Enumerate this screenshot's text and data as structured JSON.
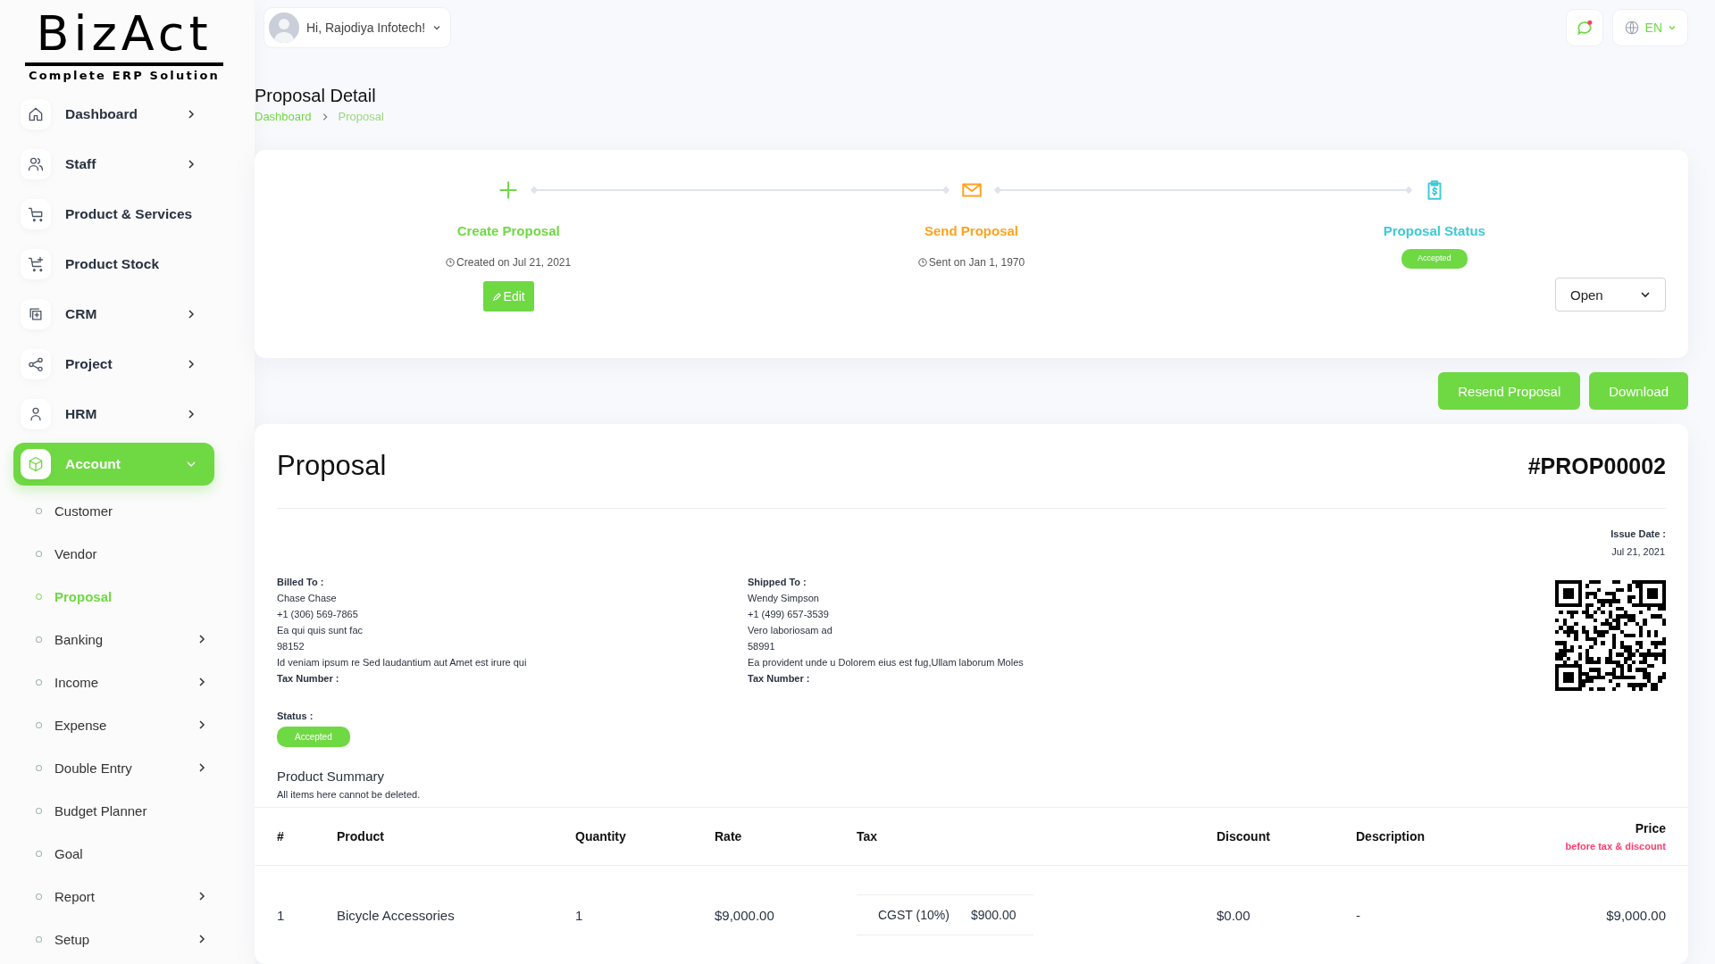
{
  "logo": {
    "title": "BizAct",
    "tagline": "Complete ERP Solution"
  },
  "sidebar": {
    "items": [
      {
        "label": "Dashboard",
        "selected": false,
        "has_submenu": true,
        "expanded": false
      },
      {
        "label": "Staff",
        "selected": false,
        "has_submenu": true,
        "expanded": false
      },
      {
        "label": "Product & Services",
        "selected": false,
        "has_submenu": false
      },
      {
        "label": "Product Stock",
        "selected": false,
        "has_submenu": false
      },
      {
        "label": "CRM",
        "selected": false,
        "has_submenu": true,
        "expanded": false
      },
      {
        "label": "Project",
        "selected": false,
        "has_submenu": true,
        "expanded": false
      },
      {
        "label": "HRM",
        "selected": false,
        "has_submenu": true,
        "expanded": false
      },
      {
        "label": "Account",
        "selected": true,
        "has_submenu": true,
        "expanded": true,
        "children": [
          {
            "label": "Customer",
            "selected": false,
            "has_submenu": false
          },
          {
            "label": "Vendor",
            "selected": false,
            "has_submenu": false
          },
          {
            "label": "Proposal",
            "selected": true,
            "has_submenu": false
          },
          {
            "label": "Banking",
            "selected": false,
            "has_submenu": true
          },
          {
            "label": "Income",
            "selected": false,
            "has_submenu": true
          },
          {
            "label": "Expense",
            "selected": false,
            "has_submenu": true
          },
          {
            "label": "Double Entry",
            "selected": false,
            "has_submenu": true
          },
          {
            "label": "Budget Planner",
            "selected": false,
            "has_submenu": false
          },
          {
            "label": "Goal",
            "selected": false,
            "has_submenu": false
          },
          {
            "label": "Report",
            "selected": false,
            "has_submenu": true
          },
          {
            "label": "Setup",
            "selected": false,
            "has_submenu": true
          }
        ]
      }
    ]
  },
  "header": {
    "greeting": "Hi, Rajodiya Infotech!",
    "language": "EN"
  },
  "page": {
    "title": "Proposal Detail",
    "breadcrumb": [
      "Dashboard",
      "Proposal"
    ]
  },
  "steps": [
    {
      "kind": "create",
      "title": "Create Proposal",
      "note": "Created on Jul 21, 2021",
      "action": "Edit"
    },
    {
      "kind": "send",
      "title": "Send Proposal",
      "note": "Sent on Jan 1, 1970"
    },
    {
      "kind": "status",
      "title": "Proposal Status",
      "badge": "Accepted"
    }
  ],
  "status_select": {
    "value": "Open"
  },
  "actions": [
    "Resend Proposal",
    "Download"
  ],
  "proposal": {
    "title": "Proposal",
    "number": "#PROP00002",
    "issue_date_label": "Issue Date :",
    "issue_date": "Jul 21, 2021",
    "billed": {
      "label": "Billed To :",
      "lines": [
        "Chase Chase",
        "+1 (306) 569-7865",
        "Ea qui quis sunt fac",
        "98152",
        "Id veniam ipsum re Sed laudantium aut Amet est irure qui"
      ],
      "tax_label": "Tax Number :"
    },
    "shipped": {
      "label": "Shipped To :",
      "lines": [
        "Wendy Simpson",
        "+1 (499) 657-3539",
        "Vero laboriosam ad",
        "58991",
        "Ea provident unde u Dolorem eius est fug,Ullam laborum Moles"
      ],
      "tax_label": "Tax Number :"
    },
    "status_label": "Status :",
    "status": "Accepted"
  },
  "summary": {
    "title": "Product Summary",
    "note": "All items here cannot be deleted.",
    "columns": [
      "#",
      "Product",
      "Quantity",
      "Rate",
      "Tax",
      "Discount",
      "Description",
      "Price"
    ],
    "price_note": "before tax & discount",
    "rows": [
      {
        "index": "1",
        "product": "Bicycle Accessories",
        "quantity": "1",
        "rate": "$9,000.00",
        "taxes": [
          {
            "name": "CGST (10%)",
            "amount": "$900.00"
          }
        ],
        "discount": "$0.00",
        "description": "-",
        "price": "$9,000.00"
      }
    ]
  }
}
